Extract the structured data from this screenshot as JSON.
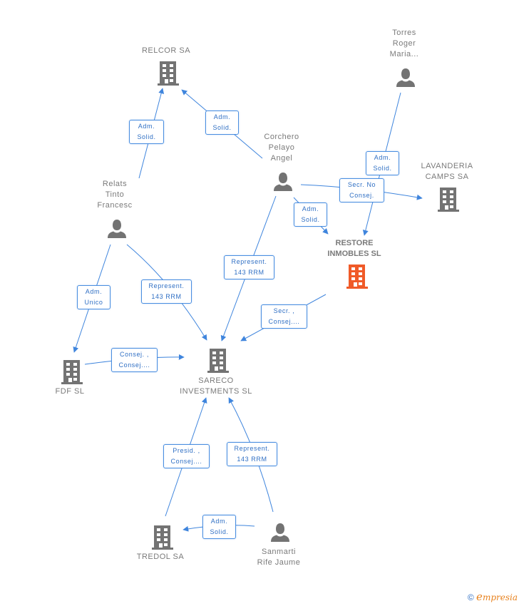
{
  "diagram": {
    "focus_color": "#f05a28",
    "node_color": "#737373",
    "edge_color": "#3f85dd",
    "nodes": [
      {
        "id": "relcor",
        "type": "company",
        "label_lines": [
          "RELCOR SA"
        ]
      },
      {
        "id": "torres",
        "type": "person",
        "label_lines": [
          "Torres",
          "Roger",
          "Maria..."
        ]
      },
      {
        "id": "corchero",
        "type": "person",
        "label_lines": [
          "Corchero",
          "Pelayo",
          "Angel"
        ]
      },
      {
        "id": "lavanderia",
        "type": "company",
        "label_lines": [
          "LAVANDERIA",
          "CAMPS SA"
        ]
      },
      {
        "id": "relats",
        "type": "person",
        "label_lines": [
          "Relats",
          "Tinto",
          "Francesc"
        ]
      },
      {
        "id": "restore",
        "type": "company",
        "focus": true,
        "label_lines": [
          "RESTORE",
          "INMOBLES SL"
        ]
      },
      {
        "id": "fdf",
        "type": "company",
        "label_lines": [
          "FDF SL"
        ]
      },
      {
        "id": "sareco",
        "type": "company",
        "label_lines": [
          "SARECO",
          "INVESTMENTS SL"
        ]
      },
      {
        "id": "tredol",
        "type": "company",
        "label_lines": [
          "TREDOL SA"
        ]
      },
      {
        "id": "sanmarti",
        "type": "person",
        "label_lines": [
          "Sanmarti",
          "Rife Jaume"
        ]
      }
    ],
    "edges": [
      {
        "from": "relats",
        "to": "relcor",
        "label_lines": [
          "Adm.",
          "Solid."
        ]
      },
      {
        "from": "corchero",
        "to": "relcor",
        "label_lines": [
          "Adm.",
          "Solid."
        ]
      },
      {
        "from": "torres",
        "to": "restore",
        "label_lines": [
          "Adm.",
          "Solid."
        ]
      },
      {
        "from": "corchero",
        "to": "lavanderia",
        "label_lines": [
          "Secr. No",
          "Consej."
        ]
      },
      {
        "from": "corchero",
        "to": "restore",
        "label_lines": [
          "Adm.",
          "Solid."
        ]
      },
      {
        "from": "corchero",
        "to": "sareco",
        "label_lines": [
          "Represent.",
          "143 RRM"
        ]
      },
      {
        "from": "restore",
        "to": "sareco",
        "label_lines": [
          "Secr. ,",
          "Consej...."
        ]
      },
      {
        "from": "relats",
        "to": "fdf",
        "label_lines": [
          "Adm.",
          "Unico"
        ]
      },
      {
        "from": "relats",
        "to": "sareco",
        "label_lines": [
          "Represent.",
          "143 RRM"
        ]
      },
      {
        "from": "fdf",
        "to": "sareco",
        "label_lines": [
          "Consej. ,",
          "Consej...."
        ]
      },
      {
        "from": "tredol",
        "to": "sareco",
        "label_lines": [
          "Presid. ,",
          "Consej...."
        ]
      },
      {
        "from": "sanmarti",
        "to": "sareco",
        "label_lines": [
          "Represent.",
          "143 RRM"
        ]
      },
      {
        "from": "sanmarti",
        "to": "tredol",
        "label_lines": [
          "Adm.",
          "Solid."
        ]
      }
    ]
  },
  "footer": {
    "copyright_symbol": "©",
    "brand_initial": "e",
    "brand_rest": "mpresia"
  }
}
